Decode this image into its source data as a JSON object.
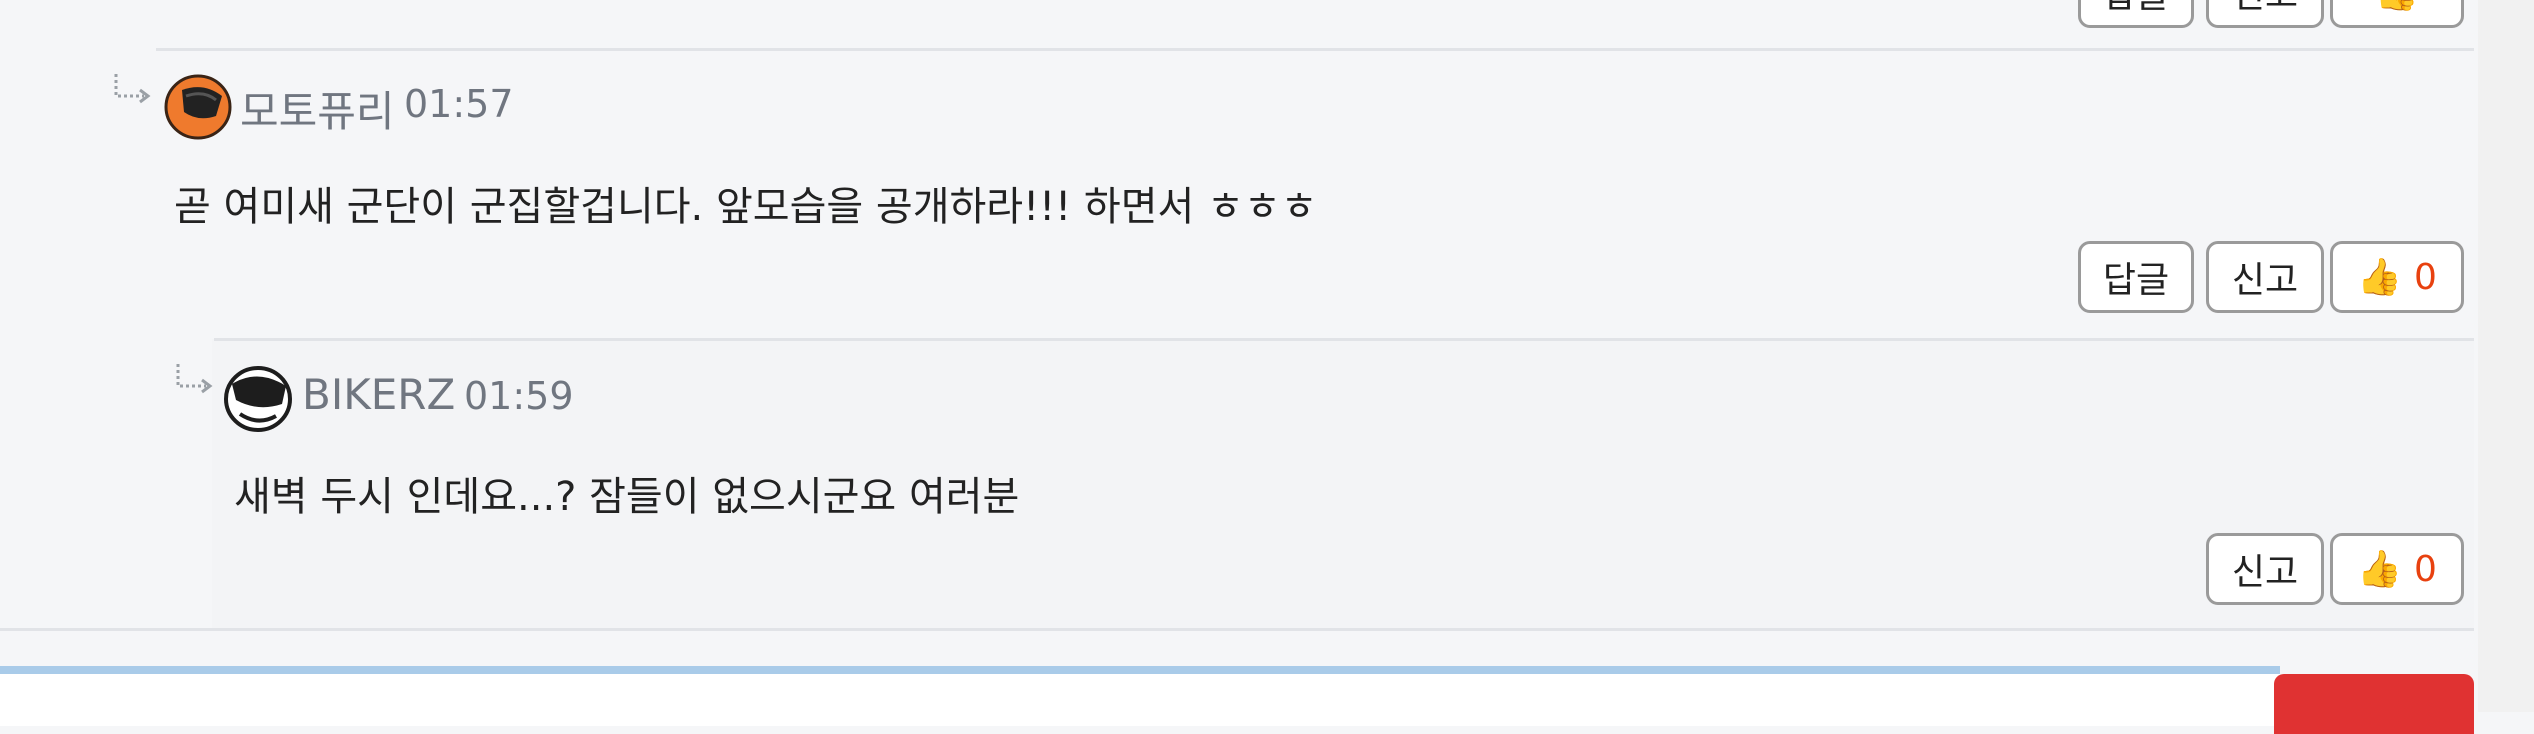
{
  "buttons": {
    "reply": "답글",
    "report": "신고"
  },
  "comments": [
    {
      "author": "모토퓨리",
      "time": "01:57",
      "text": "곧 여미새 군단이 군집할겁니다. 앞모습을 공개하라!!! 하면서 ㅎㅎㅎ",
      "likes": "0",
      "avatar_color": "#ef7a2d"
    },
    {
      "author": "BIKERZ",
      "time": "01:59",
      "text": "새벽 두시 인데요...? 잠들이 없으시군요 여러분",
      "likes": "0",
      "avatar_color": "#1d1d1d"
    }
  ],
  "colors": {
    "like": "#e8410f",
    "submit": "#e03232",
    "input_border": "#a9cbe9"
  }
}
